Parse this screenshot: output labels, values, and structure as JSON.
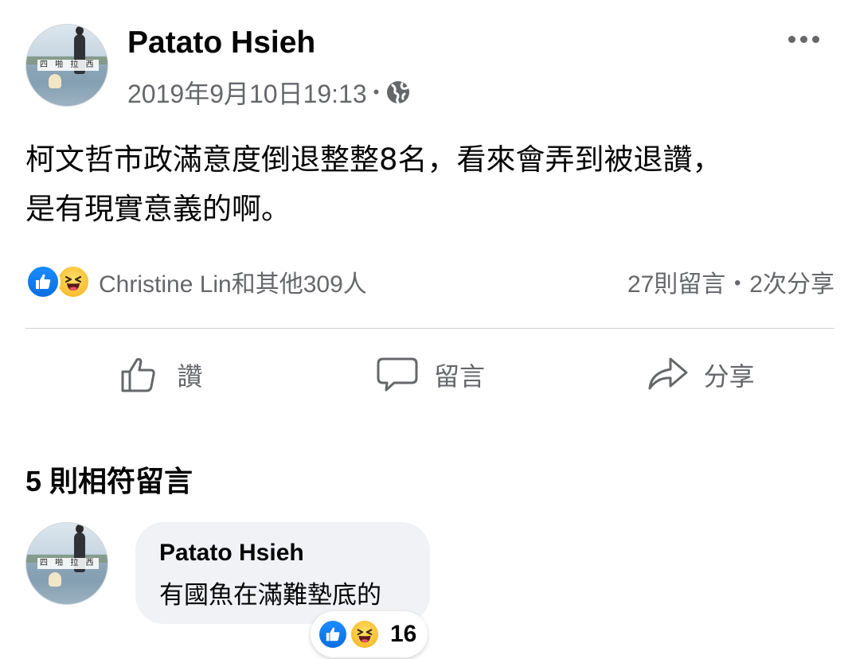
{
  "post": {
    "author": "Patato Hsieh",
    "avatar_tag": "四 啪 拉 西",
    "timestamp": "2019年9月10日19:13",
    "meta_separator": "•",
    "privacy_icon": "globe-icon",
    "more_icon": "more-options-icon",
    "text_line1": "柯文哲市政滿意度倒退整整8名，看來會弄到被退讚，",
    "text_line2": "是有現實意義的啊。"
  },
  "reactions": {
    "icons": [
      "like-icon",
      "haha-icon"
    ],
    "summary": "Christine Lin和其他309人",
    "stats": "27則留言・2次分享"
  },
  "actions": {
    "like_label": "讚",
    "comment_label": "留言",
    "share_label": "分享"
  },
  "comments": {
    "title": "5 則相符留言",
    "items": [
      {
        "author": "Patato Hsieh",
        "avatar_tag": "四 啪 拉 西",
        "text": "有國魚在滿難墊底的",
        "reaction_count": "16"
      }
    ]
  },
  "colors": {
    "secondary_text": "#65676b",
    "primary_text": "#050505",
    "bubble_bg": "#f0f2f5",
    "like_blue": "#1877f2",
    "haha_yellow": "#f7b928",
    "divider": "#ced0d4"
  }
}
